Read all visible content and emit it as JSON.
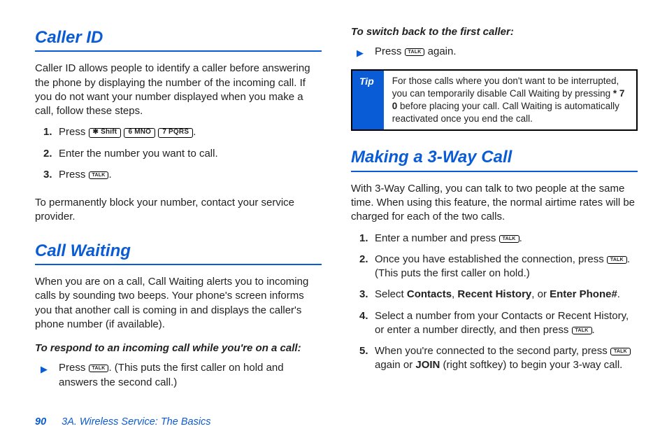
{
  "left": {
    "h_caller_id": "Caller ID",
    "caller_id_intro": "Caller ID allows people to identify a caller before answering the phone by displaying the number of the incoming call. If you do not want your number displayed when you make a call, follow these steps.",
    "steps_caller_id": {
      "s1a": "Press ",
      "s1b": ".",
      "s2": "Enter the number you want to call.",
      "s3a": "Press ",
      "s3b": "."
    },
    "caller_id_note": "To permanently block your number, contact your service provider.",
    "h_call_waiting": "Call Waiting",
    "call_waiting_intro": "When you are on a call, Call Waiting alerts you to incoming calls by sounding two beeps. Your phone's screen informs you that another call is coming in and displays the caller's phone number (if available).",
    "sub_respond": "To respond to an incoming call while you're on a call:",
    "respond_a": "Press ",
    "respond_b": ". (This puts the first caller on hold and answers the second call.)"
  },
  "right": {
    "sub_switch": "To switch back to the first caller:",
    "switch_a": "Press ",
    "switch_b": " again.",
    "tip_label": "Tip",
    "tip_text_a": "For those calls where you don't want to be interrupted, you can temporarily disable Call Waiting by pressing ",
    "tip_text_b": "* 7 0",
    "tip_text_c": " before placing your call. Call Waiting is automatically reactivated once you end the call.",
    "h_3way": "Making a 3-Way Call",
    "threeway_intro": "With 3-Way Calling, you can talk to two people at the same time. When using this feature, the normal airtime rates will be charged for each of the two calls.",
    "steps_3way": {
      "s1a": "Enter a number and press ",
      "s1b": ".",
      "s2a": "Once you have established the connection, press ",
      "s2b": ". (This puts the first caller on hold.)",
      "s3a": "Select ",
      "s3b": "Contacts",
      "s3c": ", ",
      "s3d": "Recent History",
      "s3e": ", or ",
      "s3f": "Enter Phone#",
      "s3g": ".",
      "s4a": "Select a number from your Contacts or Recent History, or enter a number directly, and then press ",
      "s4b": ".",
      "s5a": "When you're connected to the second party, press ",
      "s5b": " again or ",
      "s5c": "JOIN",
      "s5d": " (right softkey) to begin your 3-way call."
    }
  },
  "keys": {
    "star": "✱ Shift",
    "six": "6 MNO",
    "seven": "7 PQRS",
    "talk": "TALK"
  },
  "footer": {
    "page": "90",
    "title": "3A. Wireless Service: The Basics"
  }
}
